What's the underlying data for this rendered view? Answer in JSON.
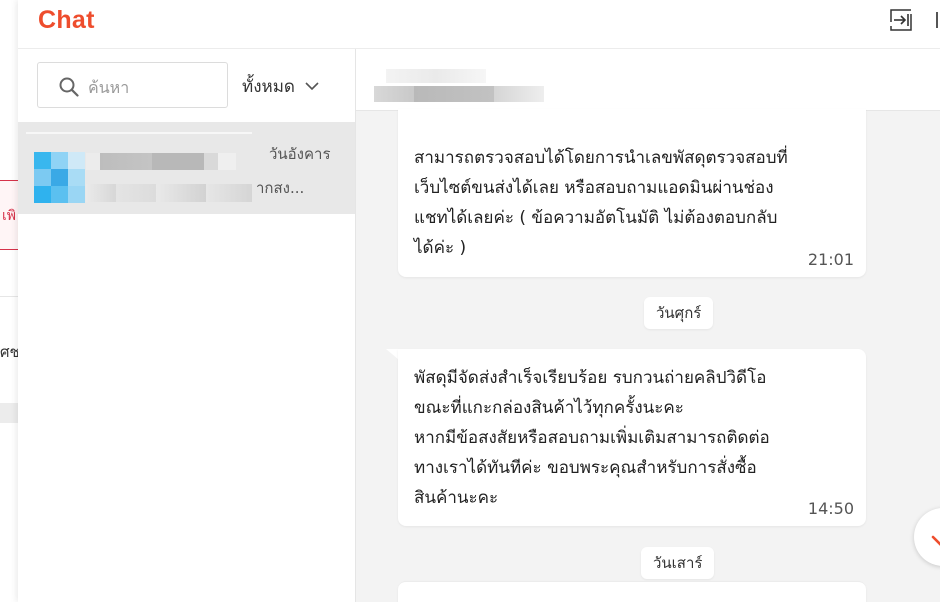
{
  "background_page": {
    "tab_label_fragment": "เพิ",
    "text_fragment": "ศช"
  },
  "header": {
    "logo": "Chat",
    "exit_icon": "exit-panel-icon"
  },
  "sidebar": {
    "search": {
      "placeholder": "ค้นหา",
      "value": ""
    },
    "filter": {
      "label": "ทั้งหมด",
      "icon": "chevron-down-icon"
    },
    "conversations": [
      {
        "date": "วันอังคาร",
        "preview": "ากสง..."
      }
    ]
  },
  "chat": {
    "messages": [
      {
        "text": "สามารถตรวจสอบได้โดยการนำเลขพัสดุตรวจสอบที่\nเว็บไซต์ขนส่งได้เลย หรือสอบถามแอดมินผ่านช่อง\nแชทได้เลยค่ะ ( ข้อความอัตโนมัติ ไม่ต้องตอบกลับ\nได้ค่ะ )",
        "time": "21:01"
      },
      {
        "text": "พัสดุมีจัดส่งสำเร็จเรียบร้อย รบกวนถ่ายคลิปวิดีโอ\nขณะที่แกะกล่องสินค้าไว้ทุกครั้งนะคะ\nหากมีข้อสงสัยหรือสอบถามเพิ่มเติมสามารถติดต่อ\nทางเราได้ทันทีค่ะ ขอบพระคุณสำหรับการสั่งซื้อ\nสินค้านะคะ",
        "time": "14:50"
      }
    ],
    "day_separators": [
      "วันศุกร์",
      "วันเสาร์"
    ],
    "scroll_button_icon": "arrow-down-icon"
  },
  "colors": {
    "brand": "#ee4d2d",
    "accent_red": "#d6324a"
  }
}
